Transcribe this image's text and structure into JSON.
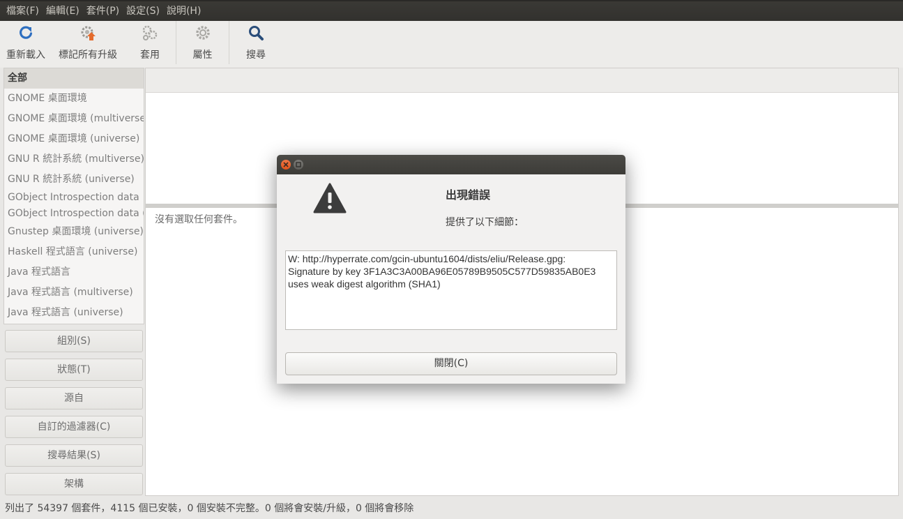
{
  "menubar": {
    "items": [
      "檔案(F)",
      "編輯(E)",
      "套件(P)",
      "設定(S)",
      "說明(H)"
    ]
  },
  "toolbar": {
    "reload": {
      "label": "重新載入",
      "icon": "reload-icon"
    },
    "mark_upgrades": {
      "label": "標記所有升級",
      "icon": "mark-upgrades-icon"
    },
    "apply": {
      "label": "套用",
      "icon": "apply-gears-icon"
    },
    "properties": {
      "label": "屬性",
      "icon": "gear-icon"
    },
    "search": {
      "label": "搜尋",
      "icon": "search-icon"
    }
  },
  "sidebar": {
    "sections": [
      "全部",
      "GNOME 桌面環境",
      "GNOME 桌面環境 (multiverse)",
      "GNOME 桌面環境 (universe)",
      "GNU R 統計系統 (multiverse)",
      "GNU R 統計系統 (universe)",
      "GObject Introspection data",
      "GObject Introspection data (",
      "Gnustep 桌面環境 (universe)",
      "Haskell 程式語言 (universe)",
      "Java 程式語言",
      "Java 程式語言 (multiverse)",
      "Java 程式語言 (universe)"
    ],
    "selected": "全部",
    "filter_buttons": [
      "組別(S)",
      "狀態(T)",
      "源自",
      "自訂的過濾器(C)",
      "搜尋結果(S)",
      "架構"
    ]
  },
  "detail": {
    "empty_text": "沒有選取任何套件。"
  },
  "statusbar": {
    "text": "列出了 54397 個套件，4115 個已安裝，0 個安裝不完整。0 個將會安裝/升級，0 個將會移除"
  },
  "dialog": {
    "title": "出現錯誤",
    "subtitle": "提供了以下細節：",
    "message": "W: http://hyperrate.com/gcin-ubuntu1604/dists/eliu/Release.gpg:\nSignature by key 3F1A3C3A00BA96E05789B9505C577D59835AB0E3\nuses weak digest algorithm (SHA1)",
    "close_label": "關閉(C)",
    "icon": "warning-icon"
  },
  "colors": {
    "menubar_bg": "#3a3935",
    "accent_orange": "#e0531a",
    "refresh_blue": "#2e6fc0"
  }
}
